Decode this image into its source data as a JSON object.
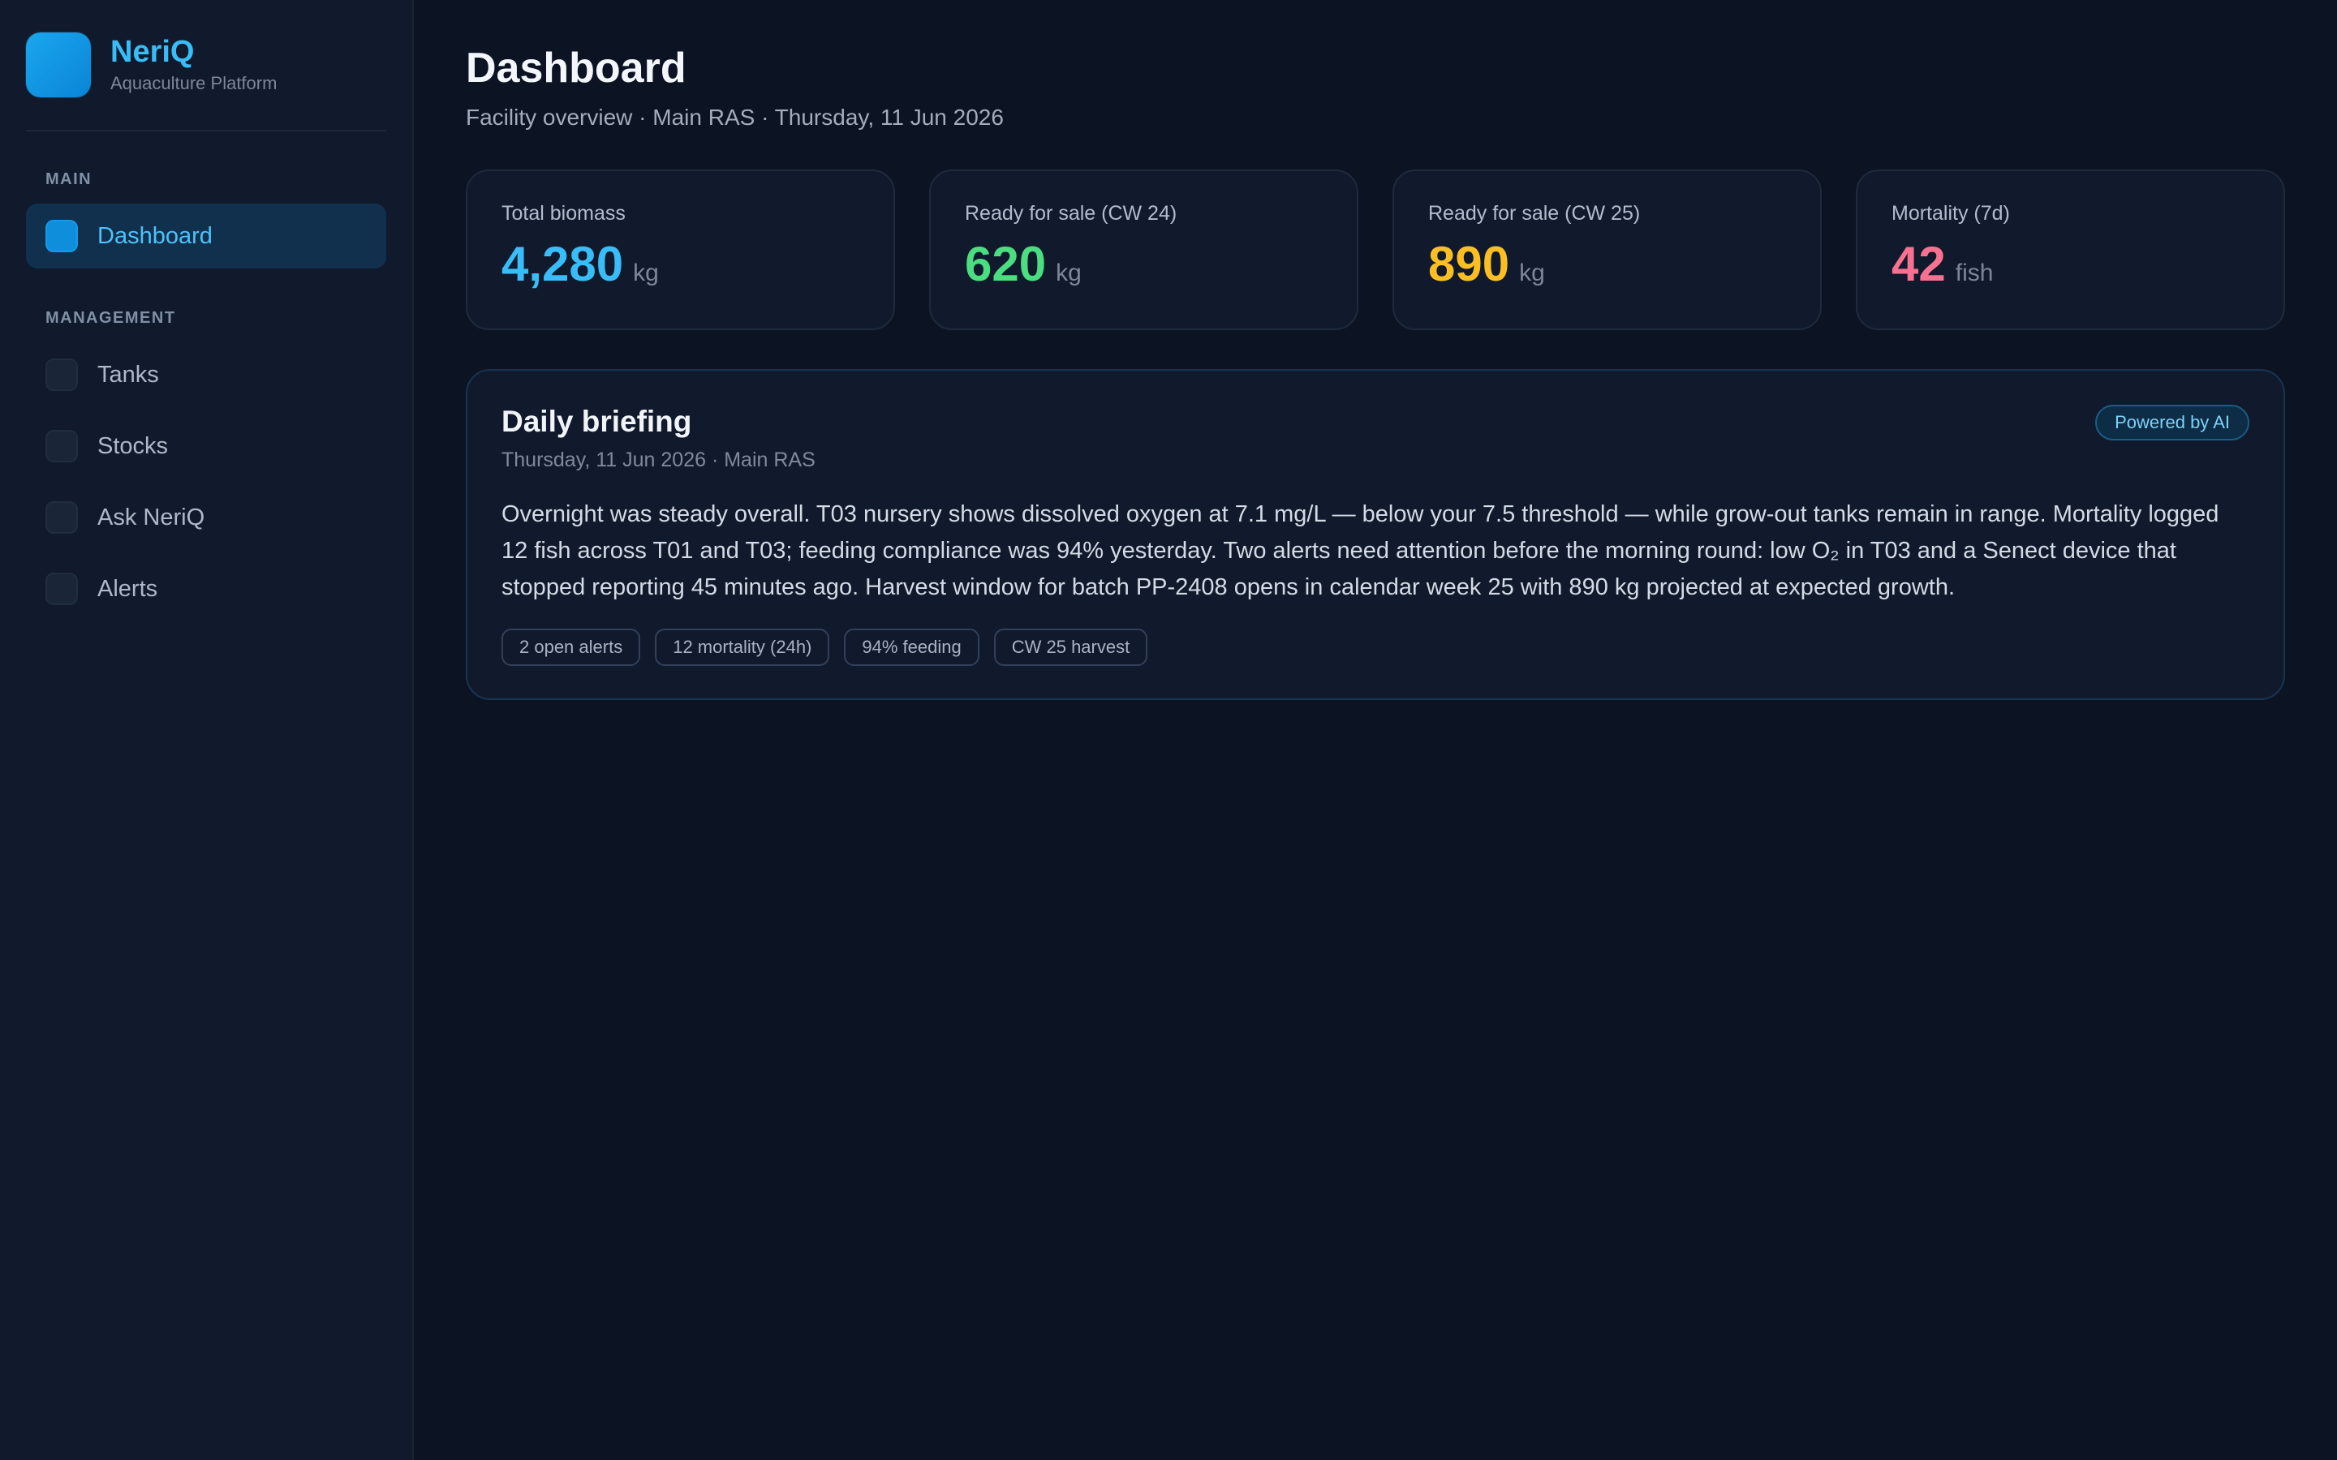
{
  "brand": {
    "name": "NeriQ",
    "subtitle": "Aquaculture Platform"
  },
  "sidebar": {
    "sections": [
      {
        "label": "MAIN",
        "items": [
          {
            "label": "Dashboard",
            "icon": "dashboard-icon",
            "active": true
          }
        ]
      },
      {
        "label": "MANAGEMENT",
        "items": [
          {
            "label": "Tanks",
            "icon": "tanks-icon"
          },
          {
            "label": "Stocks",
            "icon": "stocks-icon"
          },
          {
            "label": "Ask NeriQ",
            "icon": "ask-icon"
          },
          {
            "label": "Alerts",
            "icon": "alerts-icon"
          }
        ]
      }
    ]
  },
  "header": {
    "title": "Dashboard",
    "subtitle": "Facility overview · Main RAS · Thursday, 11 Jun 2026"
  },
  "stats": [
    {
      "label": "Total biomass",
      "value": "4,280",
      "unit": "kg",
      "color": "#38bdf8"
    },
    {
      "label": "Ready for sale (CW 24)",
      "value": "620",
      "unit": "kg",
      "color": "#4ade80"
    },
    {
      "label": "Ready for sale (CW 25)",
      "value": "890",
      "unit": "kg",
      "color": "#fbbf24"
    },
    {
      "label": "Mortality (7d)",
      "value": "42",
      "unit": "fish",
      "color": "#f87191"
    }
  ],
  "briefing": {
    "title": "Daily briefing",
    "meta": "Thursday, 11 Jun 2026 · Main RAS",
    "badge": "Powered by AI",
    "text": "Overnight was steady overall. T03 nursery shows dissolved oxygen at 7.1 mg/L — below your 7.5 threshold — while grow-out tanks remain in range. Mortality logged 12 fish across T01 and T03; feeding compliance was 94% yesterday. Two alerts need attention before the morning round: low O₂ in T03 and a Senect device that stopped reporting 45 minutes ago. Harvest window for batch PP-2408 opens in calendar week 25 with 890 kg projected at expected growth.",
    "chips": [
      "2 open alerts",
      "12 mortality (24h)",
      "94% feeding",
      "CW 25 harvest"
    ]
  }
}
